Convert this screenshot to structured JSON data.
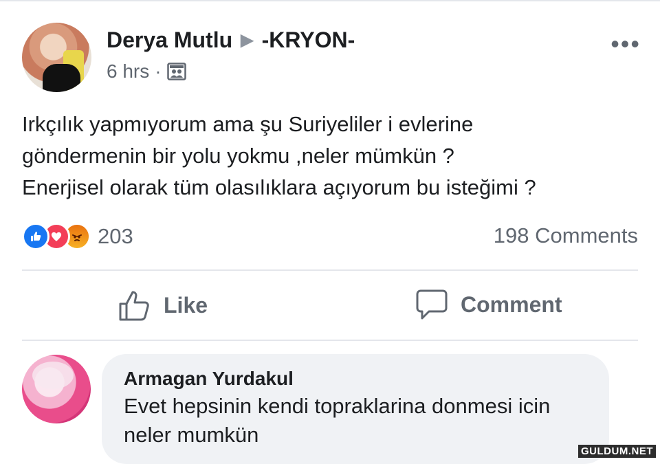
{
  "post": {
    "author": "Derya Mutlu",
    "separator_icon": "arrow-right-icon",
    "group": "-KRYON-",
    "time": "6 hrs",
    "dot": "·",
    "audience_icon": "group-icon",
    "more_label": "•••",
    "text_lines": [
      "Irkçılık yapmıyorum ama şu Suriyeliler i evlerine",
      "göndermenin bir yolu yokmu ,neler mümkün ?",
      "Enerjisel olarak tüm olasılıklara açıyorum bu isteğimi ?"
    ],
    "reaction_icons": [
      "like-icon",
      "love-icon",
      "angry-icon"
    ],
    "reaction_count": "203",
    "comment_count": "198 Comments"
  },
  "actions": {
    "like_label": "Like",
    "comment_label": "Comment"
  },
  "comment": {
    "name": "Armagan Yurdakul",
    "text": "Evet hepsinin kendi topraklarina donmesi icin neler mumkün"
  },
  "watermark": "GULDUM.NET",
  "colors": {
    "like_blue": "#1877f2",
    "love_red": "#f33e58",
    "angry_orange": "#e9710f",
    "secondary_text": "#606770",
    "bubble_bg": "#f0f2f5"
  }
}
